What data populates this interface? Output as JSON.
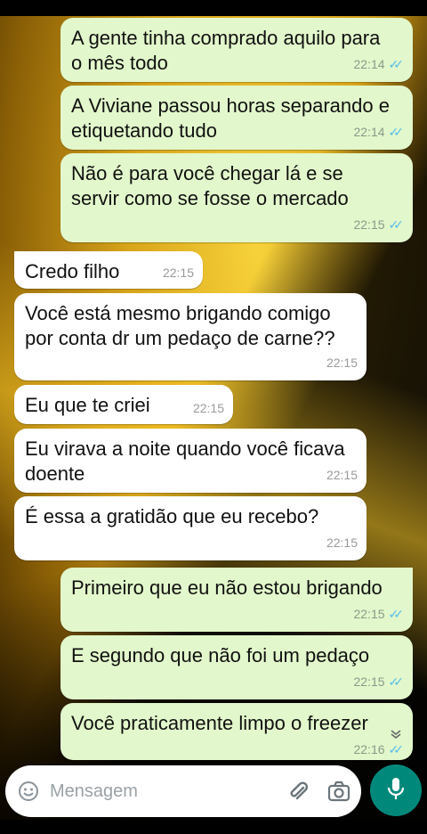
{
  "messages": [
    {
      "type": "sent",
      "text": "A gente tinha comprado aquilo para o mês todo",
      "time": "22:14",
      "status": "read"
    },
    {
      "type": "sent",
      "text": "A Viviane passou horas separando e etiquetando tudo",
      "time": "22:14",
      "status": "read"
    },
    {
      "type": "sent",
      "text": "Não é para você chegar lá e se servir como se fosse o mercado",
      "time": "22:15",
      "status": "read"
    },
    {
      "type": "received",
      "text": "Credo filho",
      "time": "22:15"
    },
    {
      "type": "received",
      "text": "Você está mesmo brigando comigo por conta dr um pedaço de carne??",
      "time": "22:15"
    },
    {
      "type": "received",
      "text": "Eu que te criei",
      "time": "22:15"
    },
    {
      "type": "received",
      "text": "Eu virava a noite quando você ficava doente",
      "time": "22:15"
    },
    {
      "type": "received",
      "text": "É essa a gratidão que eu recebo?",
      "time": "22:15"
    },
    {
      "type": "sent",
      "text": "Primeiro que eu não estou brigando",
      "time": "22:15",
      "status": "read"
    },
    {
      "type": "sent",
      "text": "E segundo que não foi um pedaço",
      "time": "22:15",
      "status": "read"
    },
    {
      "type": "sent",
      "text": "Você praticamente limpo o freezer",
      "time": "22:16",
      "status": "read"
    }
  ],
  "composer": {
    "placeholder": "Mensagem",
    "icons": [
      "emoji-icon",
      "attach-icon",
      "camera-icon",
      "mic-icon"
    ]
  },
  "colors": {
    "sent_bubble": "#e2f7cb",
    "received_bubble": "#ffffff",
    "read_ticks": "#53bdeb",
    "mic_button": "#00897b"
  }
}
